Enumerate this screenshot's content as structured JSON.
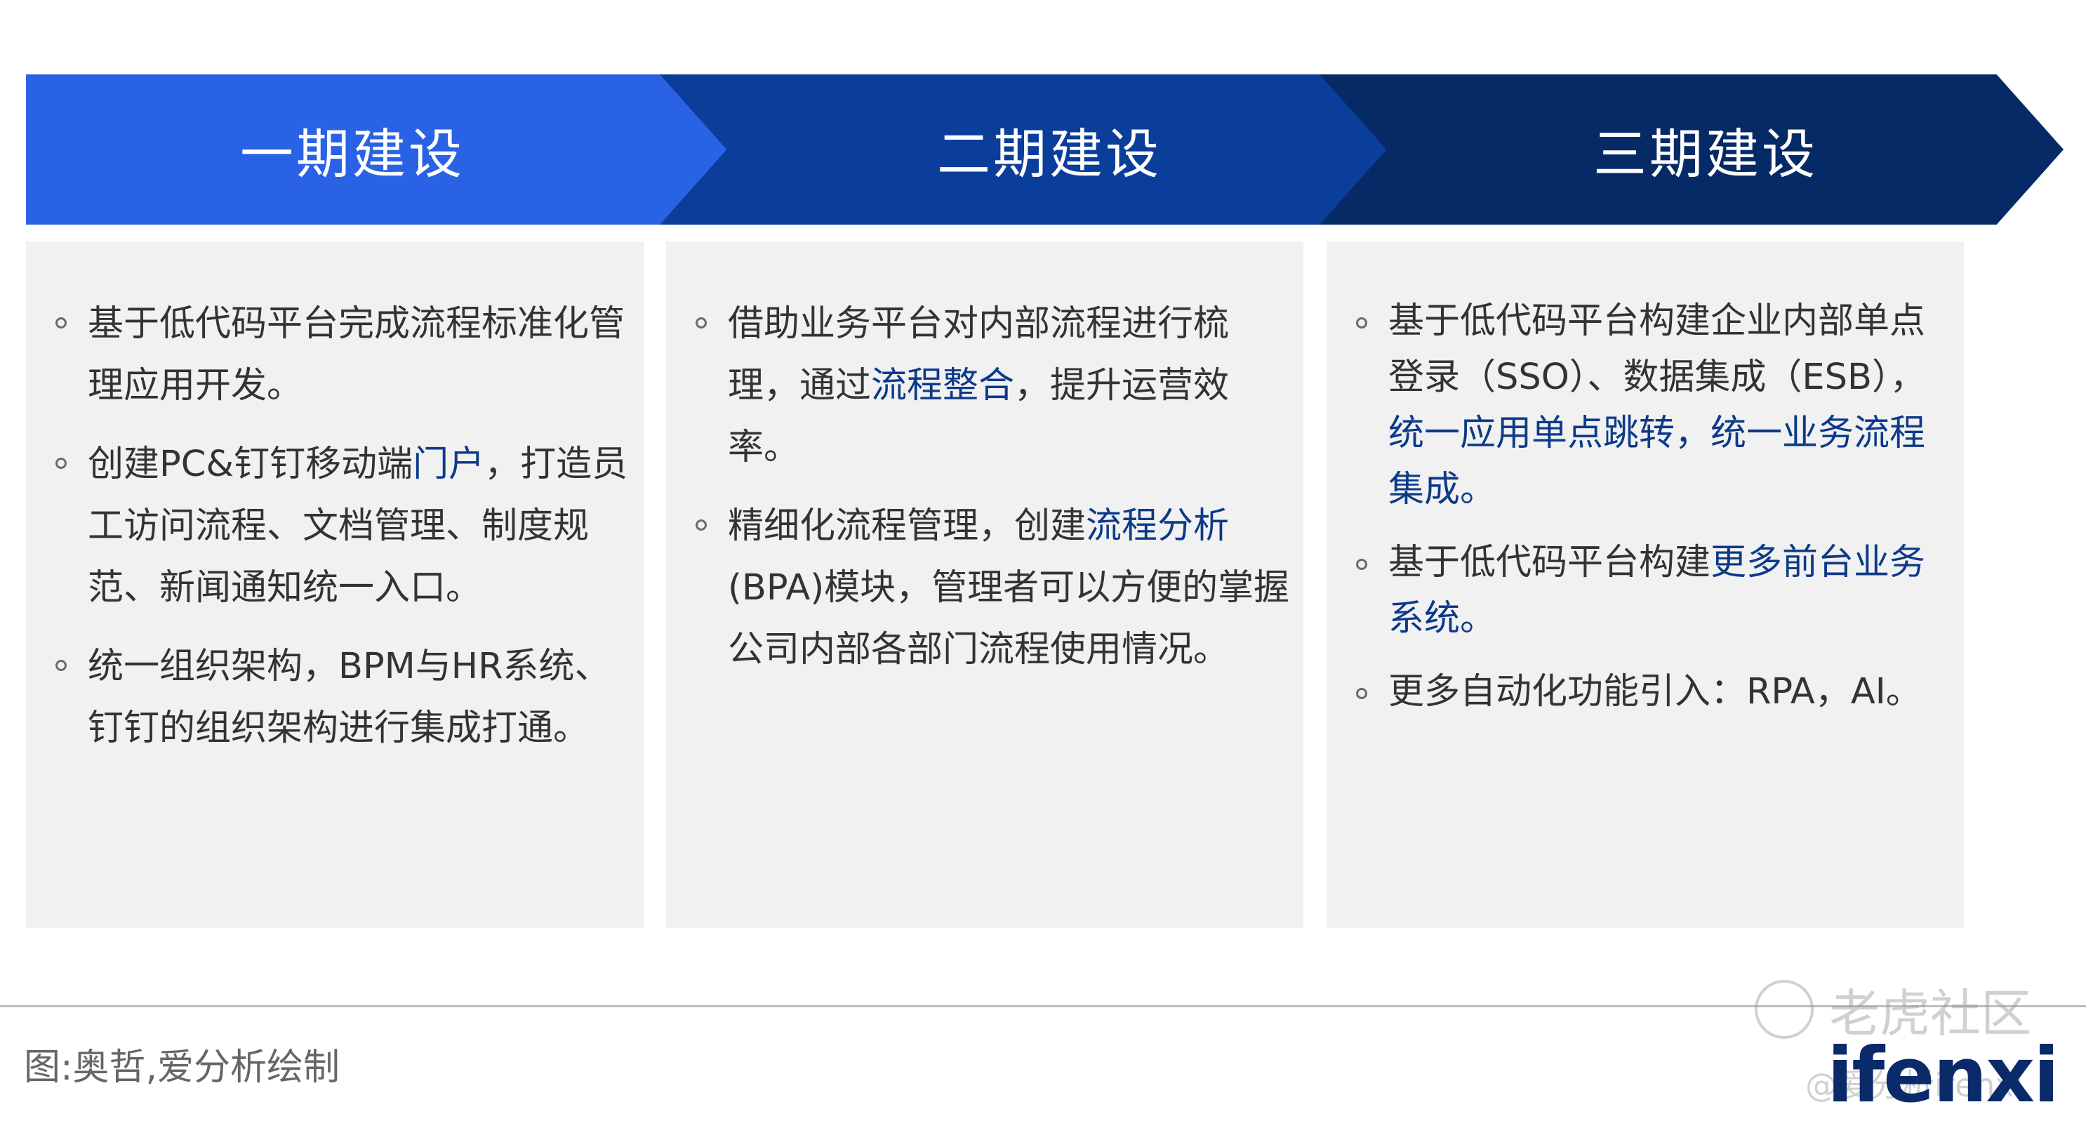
{
  "colors": {
    "phase1": "#2a62e6",
    "phase2": "#0b3d9a",
    "phase3": "#062a66",
    "panel_bg": "#f1f1f2",
    "highlight": "#0d3a88"
  },
  "phases": [
    {
      "title": "一期建设",
      "bullets": [
        [
          {
            "t": "基于低代码平台完成流程标准化管理应用开发。"
          }
        ],
        [
          {
            "t": "创建PC&钉钉移动端"
          },
          {
            "t": "门户",
            "hl": true
          },
          {
            "t": "，打造员工访问流程、文档管理、制度规范、新闻通知统一入口。"
          }
        ],
        [
          {
            "t": "统一组织架构，BPM与HR系统、钉钉的组织架构进行集成打通。"
          }
        ]
      ]
    },
    {
      "title": "二期建设",
      "bullets": [
        [
          {
            "t": "借助业务平台对内部流程进行梳理，通过"
          },
          {
            "t": "流程整合",
            "hl": true
          },
          {
            "t": "，提升运营效率。"
          }
        ],
        [
          {
            "t": "精细化流程管理，创建"
          },
          {
            "t": "流程分析",
            "hl": true
          },
          {
            "t": "(BPA)模块，管理者可以方便的掌握公司内部各部门流程使用情况。"
          }
        ]
      ]
    },
    {
      "title": "三期建设",
      "bullets": [
        [
          {
            "t": "基于低代码平台构建企业内部单点登录（SSO）、数据集成（ESB），"
          },
          {
            "t": "统一应用单点跳转，统一业务流程集成。",
            "hl": true
          }
        ],
        [
          {
            "t": "基于低代码平台构建"
          },
          {
            "t": "更多前台业务系统。",
            "hl": true
          }
        ],
        [
          {
            "t": "更多自动化功能引入：RPA，AI。"
          }
        ]
      ]
    }
  ],
  "footer": {
    "source": "图:奥哲,爱分析绘制",
    "logo": "ifenxi",
    "watermark": "老虎社区",
    "watermark_handle": "@爱分析ifenxi"
  }
}
